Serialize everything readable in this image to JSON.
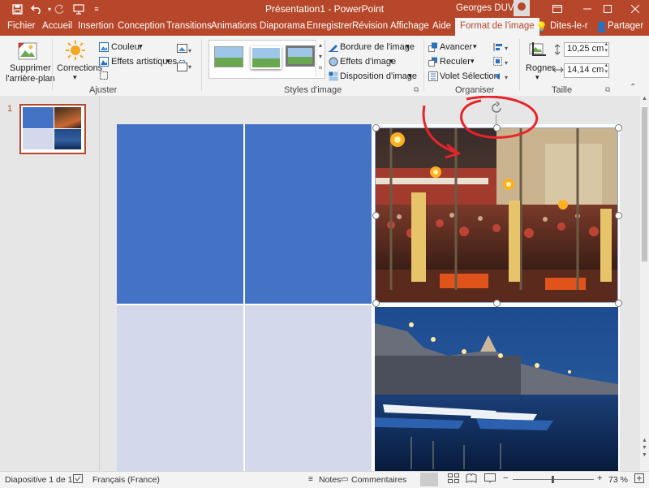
{
  "window": {
    "title": "Présentation1  -  PowerPoint",
    "user": "Georges DUVAL",
    "qat": {
      "save_icon": "save-icon",
      "undo_icon": "undo-icon",
      "redo_icon": "redo-icon",
      "start_icon": "from-beginning-icon",
      "customize_icon": "customize-qat-icon"
    }
  },
  "tabs": [
    "Fichier",
    "Accueil",
    "Insertion",
    "Conception",
    "Transitions",
    "Animations",
    "Diaporama",
    "Enregistrer",
    "Révision",
    "Affichage",
    "Aide",
    "Format de l'image",
    "Dites-le-r",
    "Partager"
  ],
  "ribbon": {
    "remove_bg": [
      "Supprimer",
      "l'arrière-plan"
    ],
    "corrections": "Corrections",
    "color": "Couleur",
    "artistic": "Effets artistiques",
    "group_adjust": "Ajuster",
    "border": "Bordure de l'image",
    "effects": "Effets d'image",
    "layout": "Disposition d'image",
    "group_styles": "Styles d'image",
    "forward": "Avancer",
    "backward": "Reculer",
    "selection": "Volet Sélection",
    "group_arrange": "Organiser",
    "crop": "Rogner",
    "height": "10,25 cm",
    "width": "14,14 cm",
    "group_size": "Taille"
  },
  "slides": {
    "number": "1"
  },
  "status": {
    "slide": "Diapositive 1 de 1",
    "language": "Français (France)",
    "notes": "Notes",
    "comments": "Commentaires",
    "zoom": "73 %"
  },
  "colors": {
    "accent": "#b7472a",
    "blue": "#4472c4",
    "lightblue": "#d3d8ea",
    "annotation": "#e8242b"
  }
}
